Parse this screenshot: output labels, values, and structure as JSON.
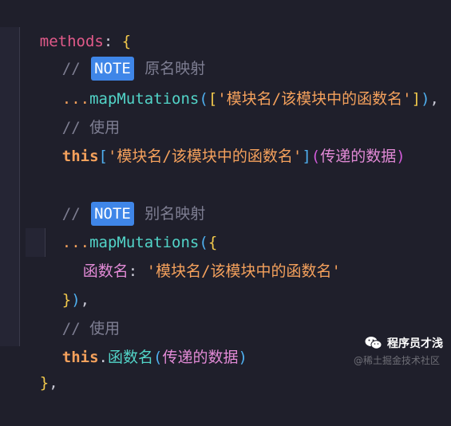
{
  "code": {
    "l1": {
      "name": "methods",
      "colon": ": ",
      "brace": "{"
    },
    "l2": {
      "comment_prefix": "// ",
      "tag": "NOTE",
      "comment_text": " 原名映射"
    },
    "l3": {
      "spread": "...",
      "fn": "mapMutations",
      "open_paren": "(",
      "open_bracket": "[",
      "str": "'模块名/该模块中的函数名'",
      "close_bracket": "]",
      "close_paren": ")",
      "comma": ","
    },
    "l4": {
      "comment": "// 使用"
    },
    "l5": {
      "this": "this",
      "open_bracket": "[",
      "str": "'模块名/该模块中的函数名'",
      "close_bracket": "]",
      "open_paren": "(",
      "args": "传递的数据",
      "close_paren": ")"
    },
    "l7": {
      "comment_prefix": "// ",
      "tag": "NOTE",
      "comment_text": " 别名映射"
    },
    "l8": {
      "spread": "...",
      "fn": "mapMutations",
      "open_paren": "(",
      "brace": "{"
    },
    "l9": {
      "key": "函数名",
      "colon": ": ",
      "str": "'模块名/该模块中的函数名'"
    },
    "l10": {
      "brace": "}",
      "close_paren": ")",
      "comma": ","
    },
    "l11": {
      "comment": "// 使用"
    },
    "l12": {
      "this": "this",
      "dot": ".",
      "fn": "函数名",
      "open_paren": "(",
      "args": "传递的数据",
      "close_paren": ")"
    },
    "l13": {
      "brace": "}",
      "comma": ","
    }
  },
  "watermark": {
    "title": "程序员才浅",
    "subtitle": "@稀土掘金技术社区"
  }
}
